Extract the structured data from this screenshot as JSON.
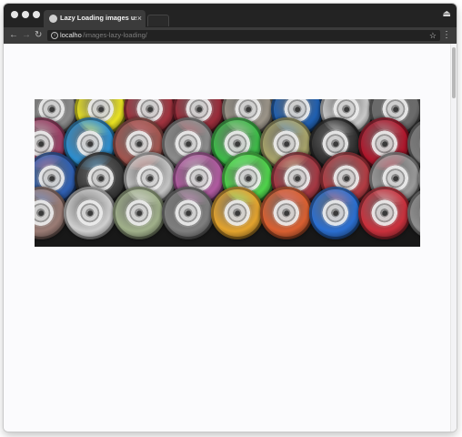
{
  "browser": {
    "tab_title": "Lazy Loading images using In",
    "tab_close": "×",
    "url_host": "localho",
    "url_path": "/images-lazy-loading/"
  },
  "icons": {
    "back": "←",
    "forward": "→",
    "reload": "↻",
    "info": "i",
    "star": "☆",
    "menu": "⋮",
    "profile": "⏏"
  },
  "main": {
    "image_alt": "Colorful spray paint cans viewed from above",
    "colors": {
      "window_bg": "#f8f9fb",
      "titlebar": "#232323",
      "toolbar": "#3b3b3b"
    },
    "can_colors": [
      "#8a8a8a",
      "#e9e221",
      "#a1323e",
      "#9a2c3a",
      "#9b9488",
      "#1f5fb0",
      "#c9c9c9",
      "#6b6b6b",
      "#9a3d63",
      "#2d8fd0",
      "#a2554f",
      "#8c8c8c",
      "#3dbb48",
      "#a8a46a",
      "#2f2f2f",
      "#b0172c",
      "#7b7b7b",
      "#2e5fb2",
      "#3a3a3a",
      "#c4c4c4",
      "#b05aa0",
      "#4ed34a",
      "#a53742",
      "#b23b42",
      "#9a9a9a",
      "#b7b7b7",
      "#9a7b74",
      "#cfcfcf",
      "#a0b08a",
      "#7e7e7e",
      "#e3a32d",
      "#d95f30",
      "#2a6ed0",
      "#c9303c",
      "#8e8e8e"
    ]
  }
}
